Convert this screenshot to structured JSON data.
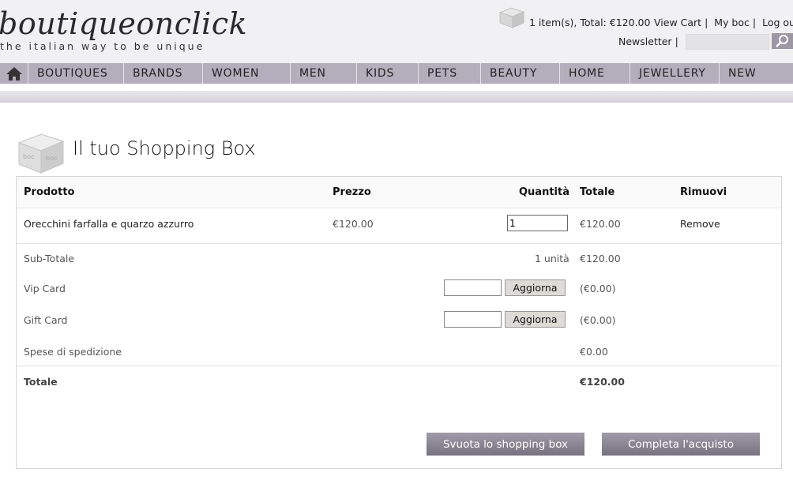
{
  "brand": {
    "name": "boutiqueonclick",
    "tagline": "the italian way to be unique"
  },
  "header": {
    "cart_summary": "1 item(s), Total: €120.00",
    "links": [
      "View Cart",
      "My boc",
      "Log ou"
    ],
    "newsletter_label": "Newsletter"
  },
  "nav": {
    "items": [
      "BOUTIQUES",
      "BRANDS",
      "WOMEN",
      "MEN",
      "KIDS",
      "PETS",
      "BEAUTY",
      "HOME",
      "JEWELLERY",
      "NEW"
    ]
  },
  "page": {
    "title": "Il tuo Shopping Box"
  },
  "table": {
    "headers": {
      "product": "Prodotto",
      "price": "Prezzo",
      "quantity": "Quantità",
      "total": "Totale",
      "remove": "Rimuovi"
    },
    "items": [
      {
        "product": "Orecchini farfalla e quarzo azzurro",
        "price": "€120.00",
        "quantity": "1",
        "total": "€120.00",
        "remove": "Remove"
      }
    ],
    "subtotal": {
      "label": "Sub-Totale",
      "units": "1 unità",
      "value": "€120.00"
    },
    "vip_card": {
      "label": "Vip Card",
      "button": "Aggiorna",
      "value": "(€0.00)"
    },
    "gift_card": {
      "label": "Gift Card",
      "button": "Aggiorna",
      "value": "(€0.00)"
    },
    "shipping": {
      "label": "Spese di spedizione",
      "value": "€0.00"
    },
    "total": {
      "label": "Totale",
      "value": "€120.00"
    }
  },
  "actions": {
    "empty_box": "Svuota lo shopping box",
    "checkout": "Completa l'acquisto"
  },
  "colors": {
    "nav_bg": "#b3aebb",
    "button_bg": "#8a8693",
    "header_bg": "#f1f1f3"
  }
}
